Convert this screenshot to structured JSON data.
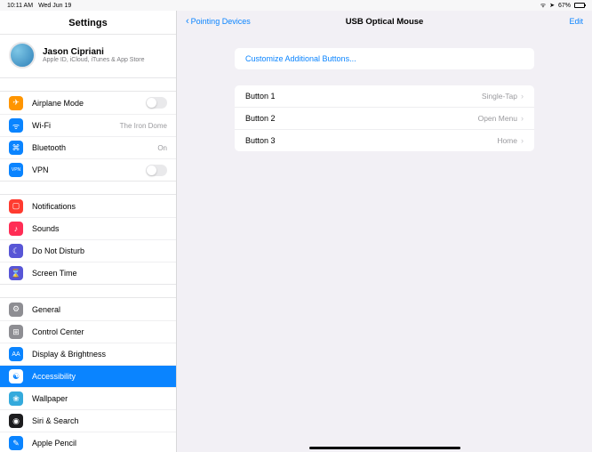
{
  "status": {
    "time": "10:11 AM",
    "date": "Wed Jun 19",
    "wifi_glyph": "ᯤ",
    "arrow_glyph": "➤",
    "battery_pct": "67%"
  },
  "sidebar": {
    "title": "Settings",
    "profile": {
      "name": "Jason Cipriani",
      "sub": "Apple ID, iCloud, iTunes & App Store"
    },
    "group1": {
      "airplane": "Airplane Mode",
      "wifi": "Wi-Fi",
      "wifi_detail": "The Iron Dome",
      "bt": "Bluetooth",
      "bt_detail": "On",
      "vpn": "VPN"
    },
    "group2": {
      "notifications": "Notifications",
      "sounds": "Sounds",
      "dnd": "Do Not Disturb",
      "screentime": "Screen Time"
    },
    "group3": {
      "general": "General",
      "cc": "Control Center",
      "display": "Display & Brightness",
      "accessibility": "Accessibility",
      "wallpaper": "Wallpaper",
      "siri": "Siri & Search",
      "pencil": "Apple Pencil"
    }
  },
  "detail": {
    "back_label": "Pointing Devices",
    "title": "USB Optical Mouse",
    "edit": "Edit",
    "customize": "Customize Additional Buttons...",
    "buttons": {
      "b1": {
        "label": "Button 1",
        "action": "Single-Tap"
      },
      "b2": {
        "label": "Button 2",
        "action": "Open Menu"
      },
      "b3": {
        "label": "Button 3",
        "action": "Home"
      }
    }
  },
  "icons": {
    "airplane": "✈",
    "wifi": "ᯤ",
    "bt": "⌘",
    "vpn": "VPN",
    "notif": "▢",
    "sounds": "♪",
    "dnd": "☾",
    "screentime": "⌛",
    "general": "⚙",
    "cc": "⊞",
    "display": "AA",
    "access": "☯",
    "wall": "❀",
    "siri": "◉",
    "pencil": "✎"
  }
}
